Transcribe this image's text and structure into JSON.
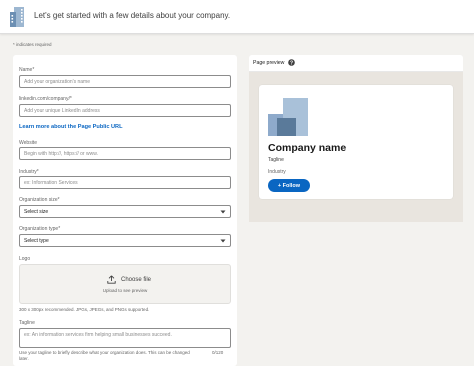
{
  "header": {
    "title": "Let's get started with a few details about your company."
  },
  "required_note": "* indicates required",
  "form": {
    "name": {
      "label": "Name*",
      "placeholder": "Add your organization's name"
    },
    "linkedin_url": {
      "label": "linkedin.com/company/*",
      "placeholder": "Add your unique LinkedIn address"
    },
    "learn_more_link": "Learn more about the Page Public URL",
    "website": {
      "label": "Website",
      "placeholder": "Begin with http://, https:// or www."
    },
    "industry": {
      "label": "Industry*",
      "placeholder": "ex: Information Services"
    },
    "org_size": {
      "label": "Organization size*",
      "value": "Select size"
    },
    "org_type": {
      "label": "Organization type*",
      "value": "Select type"
    },
    "logo": {
      "label": "Logo",
      "choose_file": "Choose file",
      "upload_hint": "Upload to see preview",
      "requirements": "300 x 300px recommended. JPGs, JPEGs, and PNGs supported."
    },
    "tagline": {
      "label": "Tagline",
      "placeholder": "ex: An information services firm helping small businesses succeed.",
      "hint": "Use your tagline to briefly describe what your organization does. This can be changed later.",
      "counter": "0/120"
    }
  },
  "preview": {
    "title": "Page preview",
    "company_name": "Company name",
    "tagline": "Tagline",
    "industry": "Industry",
    "follow_label": "Follow",
    "follow_icon": "+"
  },
  "colors": {
    "accent": "#0a66c2",
    "background": "#f3f2ef",
    "preview_bg": "#e9e5df",
    "logo_light": "#a9c1d9",
    "logo_mid": "#7a9ab9",
    "logo_dark": "#5a7a9a"
  },
  "icons": {
    "header": "company-building-icon",
    "help": "help-icon",
    "upload": "upload-icon",
    "chevron": "chevron-down-icon"
  }
}
